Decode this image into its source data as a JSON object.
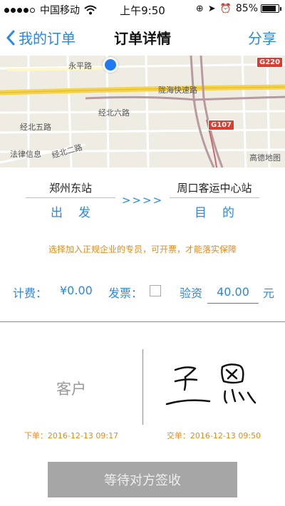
{
  "status_bar": {
    "carrier": "中国移动",
    "time": "上午9:50",
    "battery": "85%",
    "battery_level": 0.85
  },
  "nav": {
    "back_label": "我的订单",
    "title": "订单详情",
    "share_label": "分享"
  },
  "map": {
    "labels": {
      "yongping_road": "永平路",
      "longhai_expressway": "陇海快速路",
      "jingbei_six_road": "经北六路",
      "jingbei_five_road": "经北五路",
      "legal_info": "法律信息",
      "jingbei_two_road": "经北二路",
      "logo": "高德地图"
    },
    "badges": {
      "g220": "G220",
      "g107": "G107"
    }
  },
  "route": {
    "from_station": "郑州东站",
    "from_role": "出发",
    "arrows": ">>>>",
    "to_station": "周口客运中心站",
    "to_role": "目的"
  },
  "notice": "选择加入正规企业的专员，可开票，才能落实保障",
  "fees": {
    "fee_label": "计费：",
    "fee_value": "¥0.00",
    "invoice_label": "发票：",
    "invoice_checked": false,
    "deposit_label": "验资",
    "deposit_value": "40.00",
    "deposit_unit": "元"
  },
  "signatures": {
    "customer_label": "客户",
    "order_time": "下单：2016-12-13 09:17",
    "handover_time": "交单：2016-12-13 09:50"
  },
  "action": {
    "wait_label": "等待对方签收"
  },
  "colors": {
    "accent": "#2a87e8",
    "notice": "#e88a1c",
    "button_disabled": "#a6a6a6"
  }
}
